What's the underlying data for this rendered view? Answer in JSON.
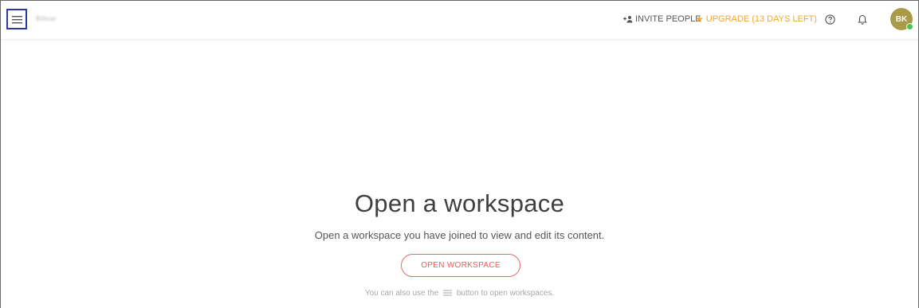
{
  "topbar": {
    "workspace_name": "Biltuar",
    "invite_label": "INVITE PEOPLE",
    "upgrade_label": "UPGRADE (13 DAYS LEFT)",
    "avatar_initials": "BK",
    "icons": {
      "menu": "hamburger-menu-icon",
      "invite": "add-person-icon",
      "upgrade": "star-icon",
      "help": "help-circle-icon",
      "notifications": "bell-icon"
    },
    "colors": {
      "menu_highlight": "#2b3aa8",
      "upgrade": "#f4a52b",
      "avatar_bg": "#a89a47",
      "presence": "#4cc05b"
    }
  },
  "main": {
    "title": "Open a workspace",
    "subtitle": "Open a workspace you have joined to view and edit its content.",
    "open_button_label": "OPEN WORKSPACE",
    "hint_prefix": "You can also use the",
    "hint_suffix": "button to open workspaces.",
    "colors": {
      "button_accent": "#e95e5e"
    }
  }
}
